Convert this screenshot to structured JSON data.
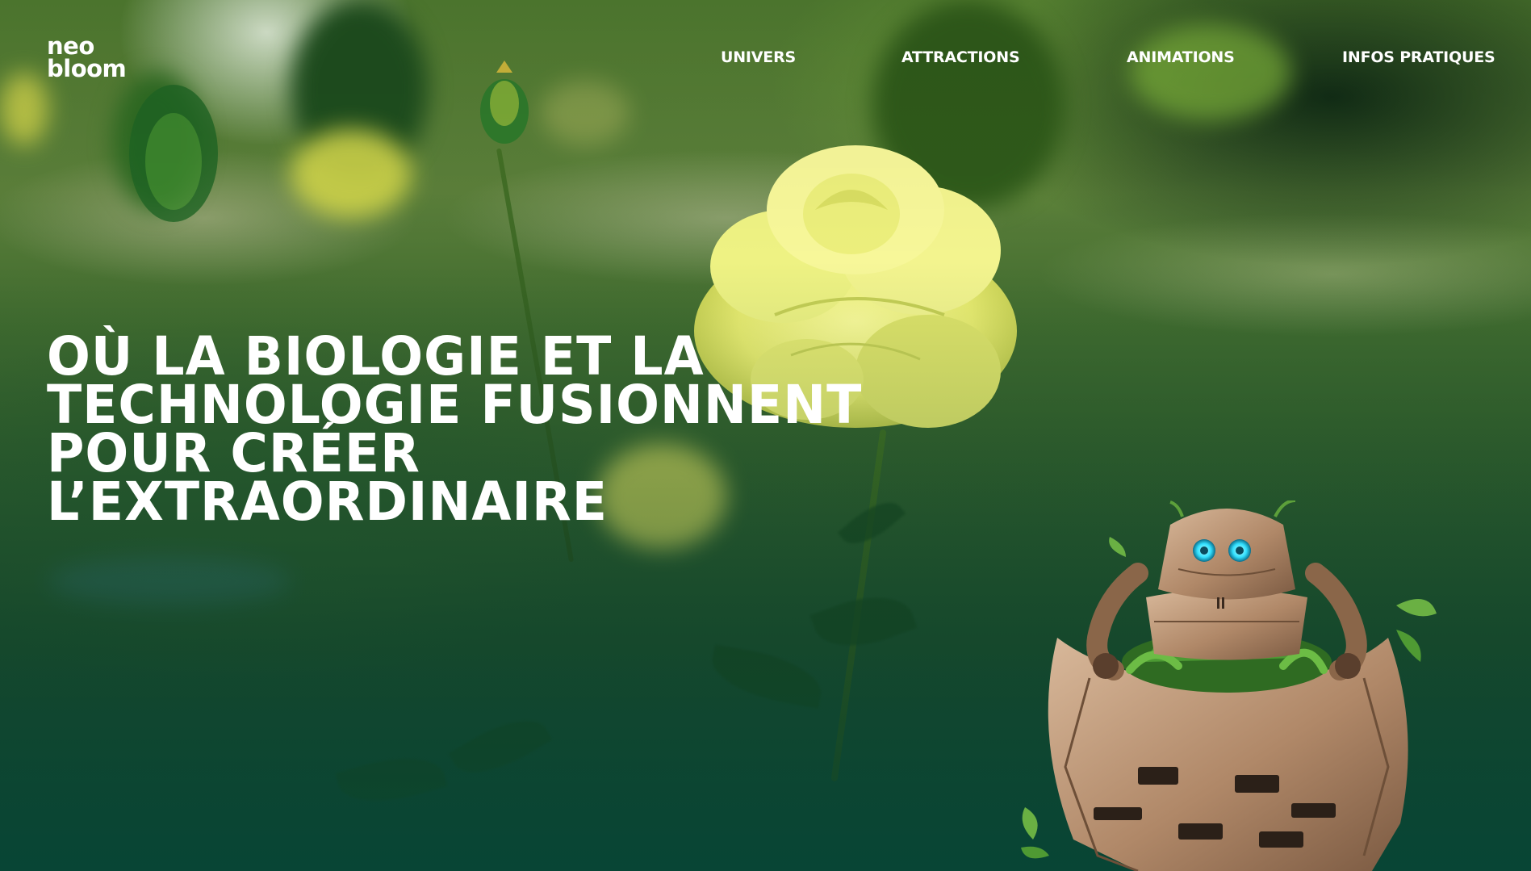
{
  "logo": {
    "line1": "neo",
    "line2": "bloom",
    "icon": "neobloom-logo"
  },
  "nav": {
    "items": [
      {
        "label": "UNIVERS"
      },
      {
        "label": "ATTRACTIONS"
      },
      {
        "label": "ANIMATIONS"
      },
      {
        "label": "INFOS PRATIQUES"
      }
    ]
  },
  "hero": {
    "headline": "OÙ LA BIOLOGIE ET LA\nTECHNOLOGIE FUSIONNENT\nPOUR CRÉER\nL’EXTRAORDINAIRE"
  },
  "media": {
    "background": "blurred-garden-with-yellow-rose",
    "mascot": "plant-robot-mascot-icon"
  },
  "colors": {
    "text": "#ffffff",
    "rose": "#eef07a",
    "robot_body": "#b8906e",
    "robot_eyes": "#33e0ff",
    "background_bottom": "#0f4330"
  }
}
